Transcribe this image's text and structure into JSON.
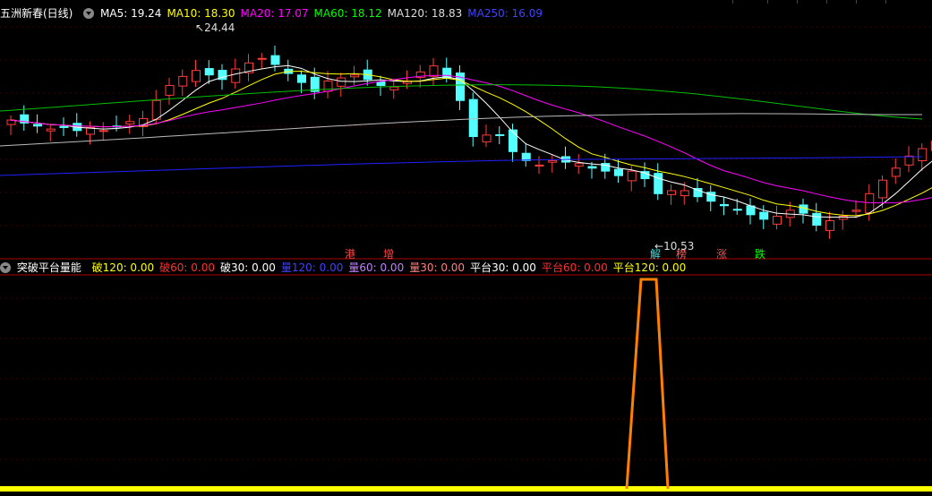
{
  "stock": {
    "title": "五洲新春(日线)"
  },
  "ma_labels": [
    {
      "text": "MA5: 19.24",
      "color": "#ffffff"
    },
    {
      "text": "MA10: 18.30",
      "color": "#ffff00"
    },
    {
      "text": "MA20: 17.07",
      "color": "#ff00ff"
    },
    {
      "text": "MA60: 18.12",
      "color": "#00ff00"
    },
    {
      "text": "MA120: 18.83",
      "color": "#dddddd"
    },
    {
      "text": "MA250: 16.09",
      "color": "#4040ff"
    }
  ],
  "price": {
    "high_label": "24.44",
    "low_label": "10.53"
  },
  "events": [
    {
      "text": "港",
      "color": "#ff4444"
    },
    {
      "text": "增",
      "color": "#ff4444"
    },
    {
      "text": "解",
      "color": "#40e0e0"
    },
    {
      "text": "榜",
      "color": "#ff6060"
    },
    {
      "text": "涨",
      "color": "#ff4444"
    },
    {
      "text": "跌",
      "color": "#00ff00"
    }
  ],
  "indicator": {
    "title": "突破平台量能",
    "labels": [
      {
        "text": "破120: 0.00",
        "color": "#ffff00"
      },
      {
        "text": "破60: 0.00",
        "color": "#ff3030"
      },
      {
        "text": "破30: 0.00",
        "color": "#ffffff"
      },
      {
        "text": "量120: 0.00",
        "color": "#4040ff"
      },
      {
        "text": "量60: 0.00",
        "color": "#c080ff"
      },
      {
        "text": "量30: 0.00",
        "color": "#ff8080"
      },
      {
        "text": "平台30: 0.00",
        "color": "#ffffff"
      },
      {
        "text": "平台60: 0.00",
        "color": "#ff3030"
      },
      {
        "text": "平台120: 0.00",
        "color": "#ffff00"
      }
    ]
  },
  "colors": {
    "up": "#ff3c3c",
    "down": "#54ffff",
    "signal": "#ff7f00",
    "baseline": "#ffff00"
  }
}
